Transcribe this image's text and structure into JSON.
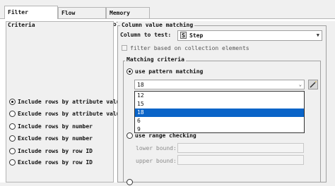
{
  "tabs": [
    {
      "label": "Filter Criteria",
      "active": true
    },
    {
      "label": "Flow Variables",
      "active": false
    },
    {
      "label": "Memory Policy",
      "active": false
    }
  ],
  "left": {
    "options": [
      {
        "label": "Include rows by attribute value",
        "selected": true
      },
      {
        "label": "Exclude rows by attribute value",
        "selected": false
      },
      {
        "label": "Include rows by number",
        "selected": false
      },
      {
        "label": "Exclude rows by number",
        "selected": false
      },
      {
        "label": "Include rows by row ID",
        "selected": false
      },
      {
        "label": "Exclude rows by row ID",
        "selected": false
      }
    ]
  },
  "column_matching": {
    "legend": "Column value matching",
    "column_label": "Column to test:",
    "column_type_badge": "S",
    "column_value": "Step",
    "collection_filter_label": "filter based on collection elements"
  },
  "matching_criteria": {
    "legend": "Matching criteria",
    "pattern_label": "use pattern matching",
    "pattern_value": "18",
    "dropdown_options": [
      "12",
      "15",
      "18",
      "6",
      "9"
    ],
    "dropdown_selected": "18",
    "range_label": "use range checking",
    "lower_label": "lower bound:",
    "upper_label": "upper bound:"
  }
}
